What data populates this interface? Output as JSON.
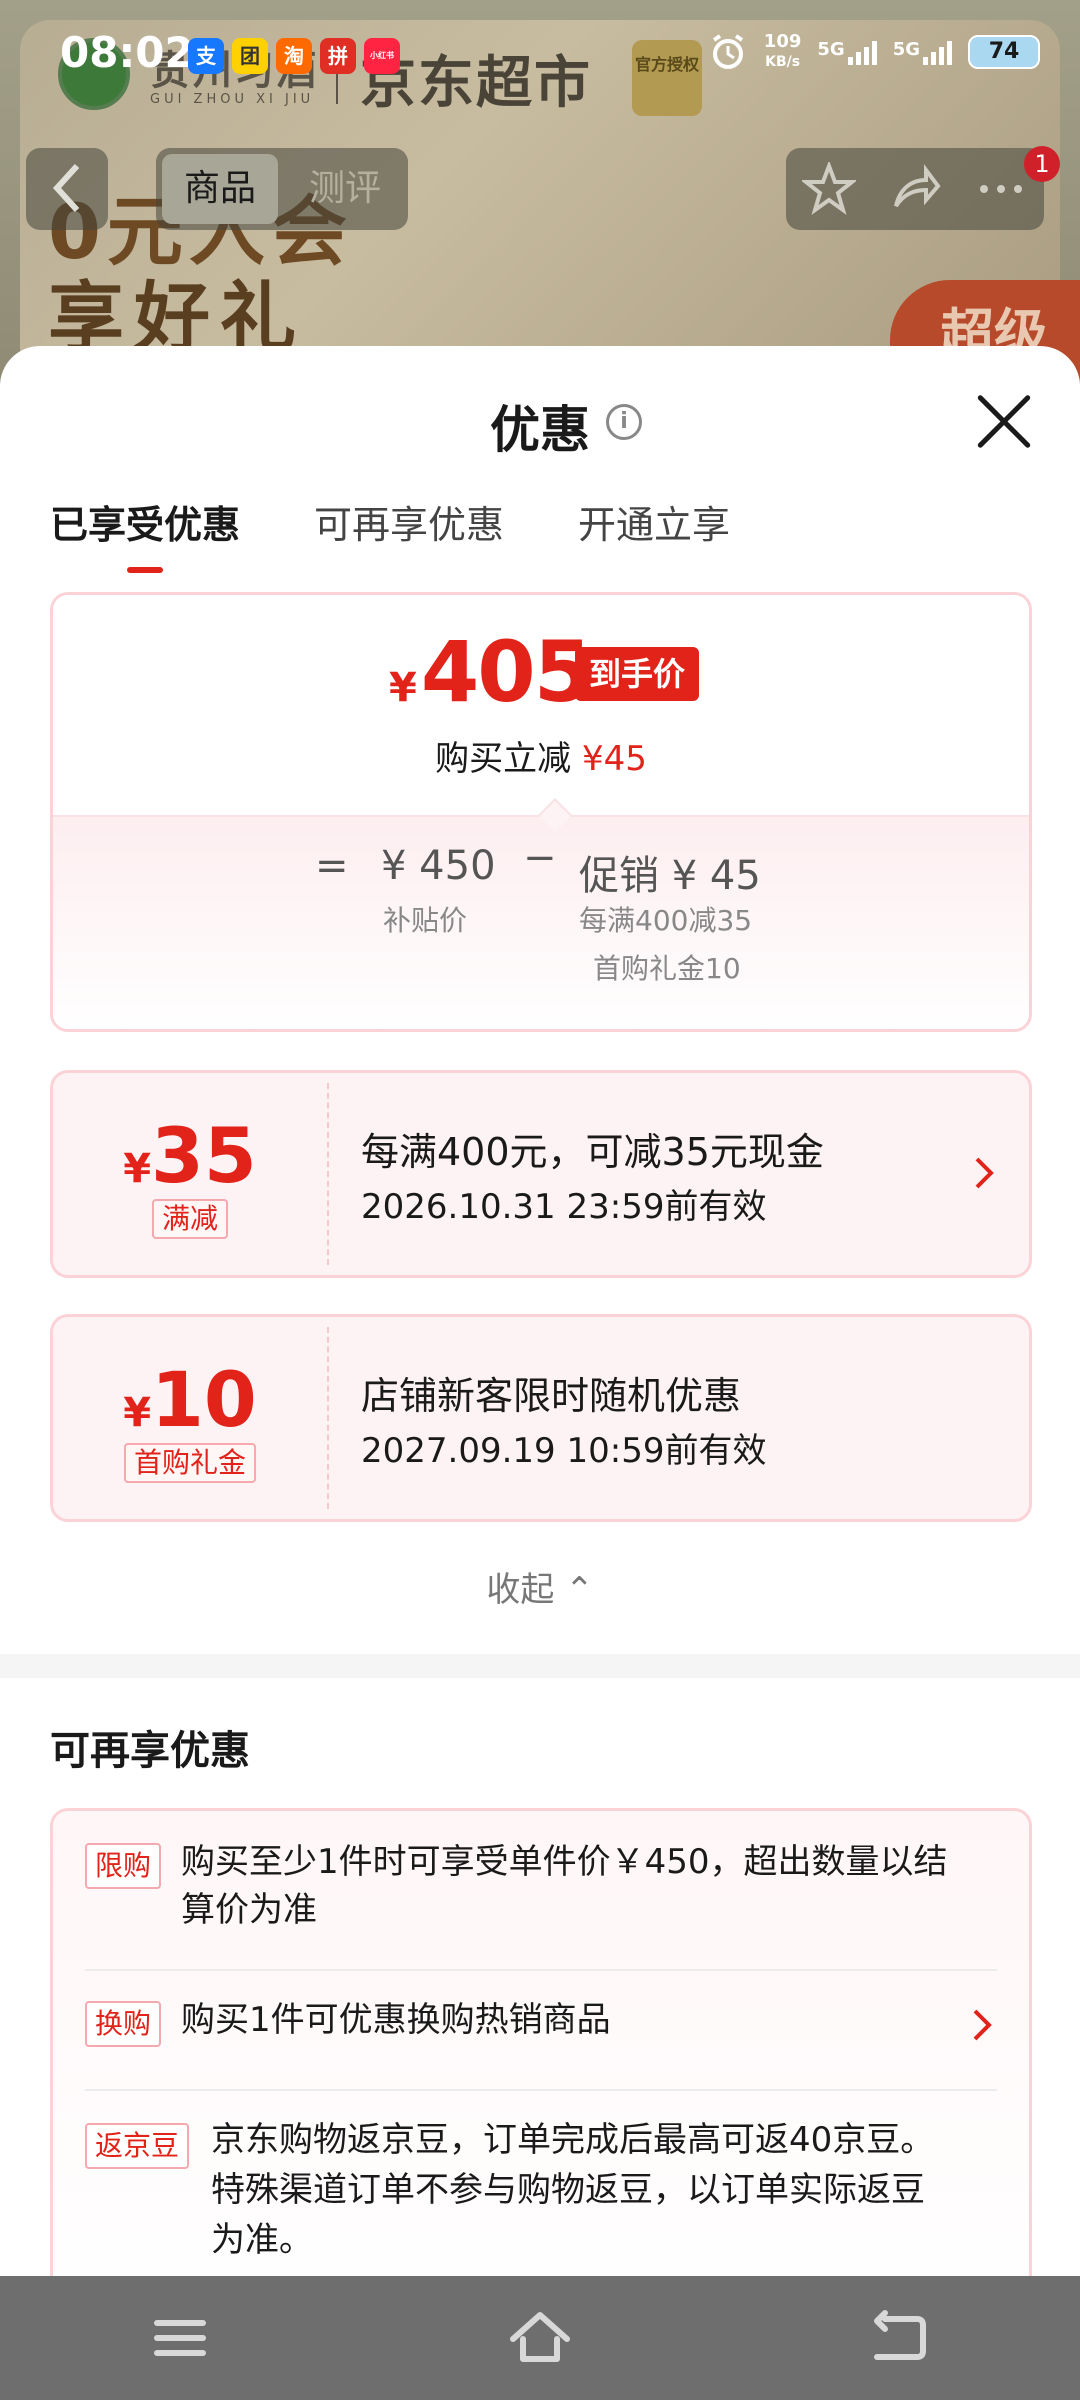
{
  "status_bar": {
    "time": "08:02",
    "apps": [
      {
        "name": "alipay-app-icon",
        "glyph": "支",
        "color": "#1677ff"
      },
      {
        "name": "meituan-app-icon",
        "glyph": "团",
        "color": "#ffd100"
      },
      {
        "name": "taobao-app-icon",
        "glyph": "淘",
        "color": "#ff6a00"
      },
      {
        "name": "pinduoduo-app-icon",
        "glyph": "拼",
        "color": "#e02e24"
      },
      {
        "name": "xiaohongshu-app-icon",
        "glyph": "小红书",
        "color": "#ff2442"
      }
    ],
    "net_speed_value": "109",
    "net_speed_unit": "KB/s",
    "signal1": "5G",
    "signal2": "5G",
    "battery": "74"
  },
  "background": {
    "brand_name": "贵州习酒",
    "brand_name_en": "GUI ZHOU XI JIU",
    "store_name": "京东超市",
    "seal_text": "官方授权",
    "promo_line1": "0元入会",
    "promo_line2": "享好礼",
    "super_label": "超级",
    "tab_product": "商品",
    "tab_review": "测评",
    "badge_count": "1"
  },
  "sheet": {
    "title": "优惠",
    "tabs": [
      {
        "label": "已享受优惠",
        "active": true
      },
      {
        "label": "可再享优惠",
        "active": false
      },
      {
        "label": "开通立享",
        "active": false
      }
    ],
    "price_card": {
      "currency": "¥",
      "final_price": "405",
      "final_tag": "到手价",
      "saved_prefix": "购买立减",
      "saved_amount": "¥45",
      "equals": "=",
      "subsidy_price": "¥ 450",
      "subsidy_label": "补贴价",
      "minus": "−",
      "promo_label": "促销 ¥ 45",
      "promo_detail1": "每满400减35",
      "promo_detail2": "首购礼金10"
    },
    "coupons": [
      {
        "currency": "¥",
        "amount": "35",
        "tag": "满减",
        "description": "每满400元，可减35元现金",
        "valid_until": "2026.10.31 23:59前有效",
        "has_arrow": true
      },
      {
        "currency": "¥",
        "amount": "10",
        "tag": "首购礼金",
        "description": "店铺新客限时随机优惠",
        "valid_until": "2027.09.19 10:59前有效",
        "has_arrow": false
      }
    ],
    "collapse_label": "收起 ⌃",
    "more_section": {
      "title": "可再享优惠",
      "items": [
        {
          "tag": "限购",
          "text_line1": "购买至少1件时可享受单件价￥450，超出数量以结",
          "text_line2": "算价为准"
        },
        {
          "tag": "换购",
          "text_line1": "购买1件可优惠换购热销商品"
        },
        {
          "tag": "返京豆",
          "text_line1": "京东购物返京豆，订单完成后最高可返40京豆。",
          "text_line2": "特殊渠道订单不参与购物返豆，以订单实际返豆",
          "text_line3": "为准。"
        }
      ]
    }
  },
  "colors": {
    "accent_red": "#e2231a",
    "card_border": "#fbd3d7"
  }
}
